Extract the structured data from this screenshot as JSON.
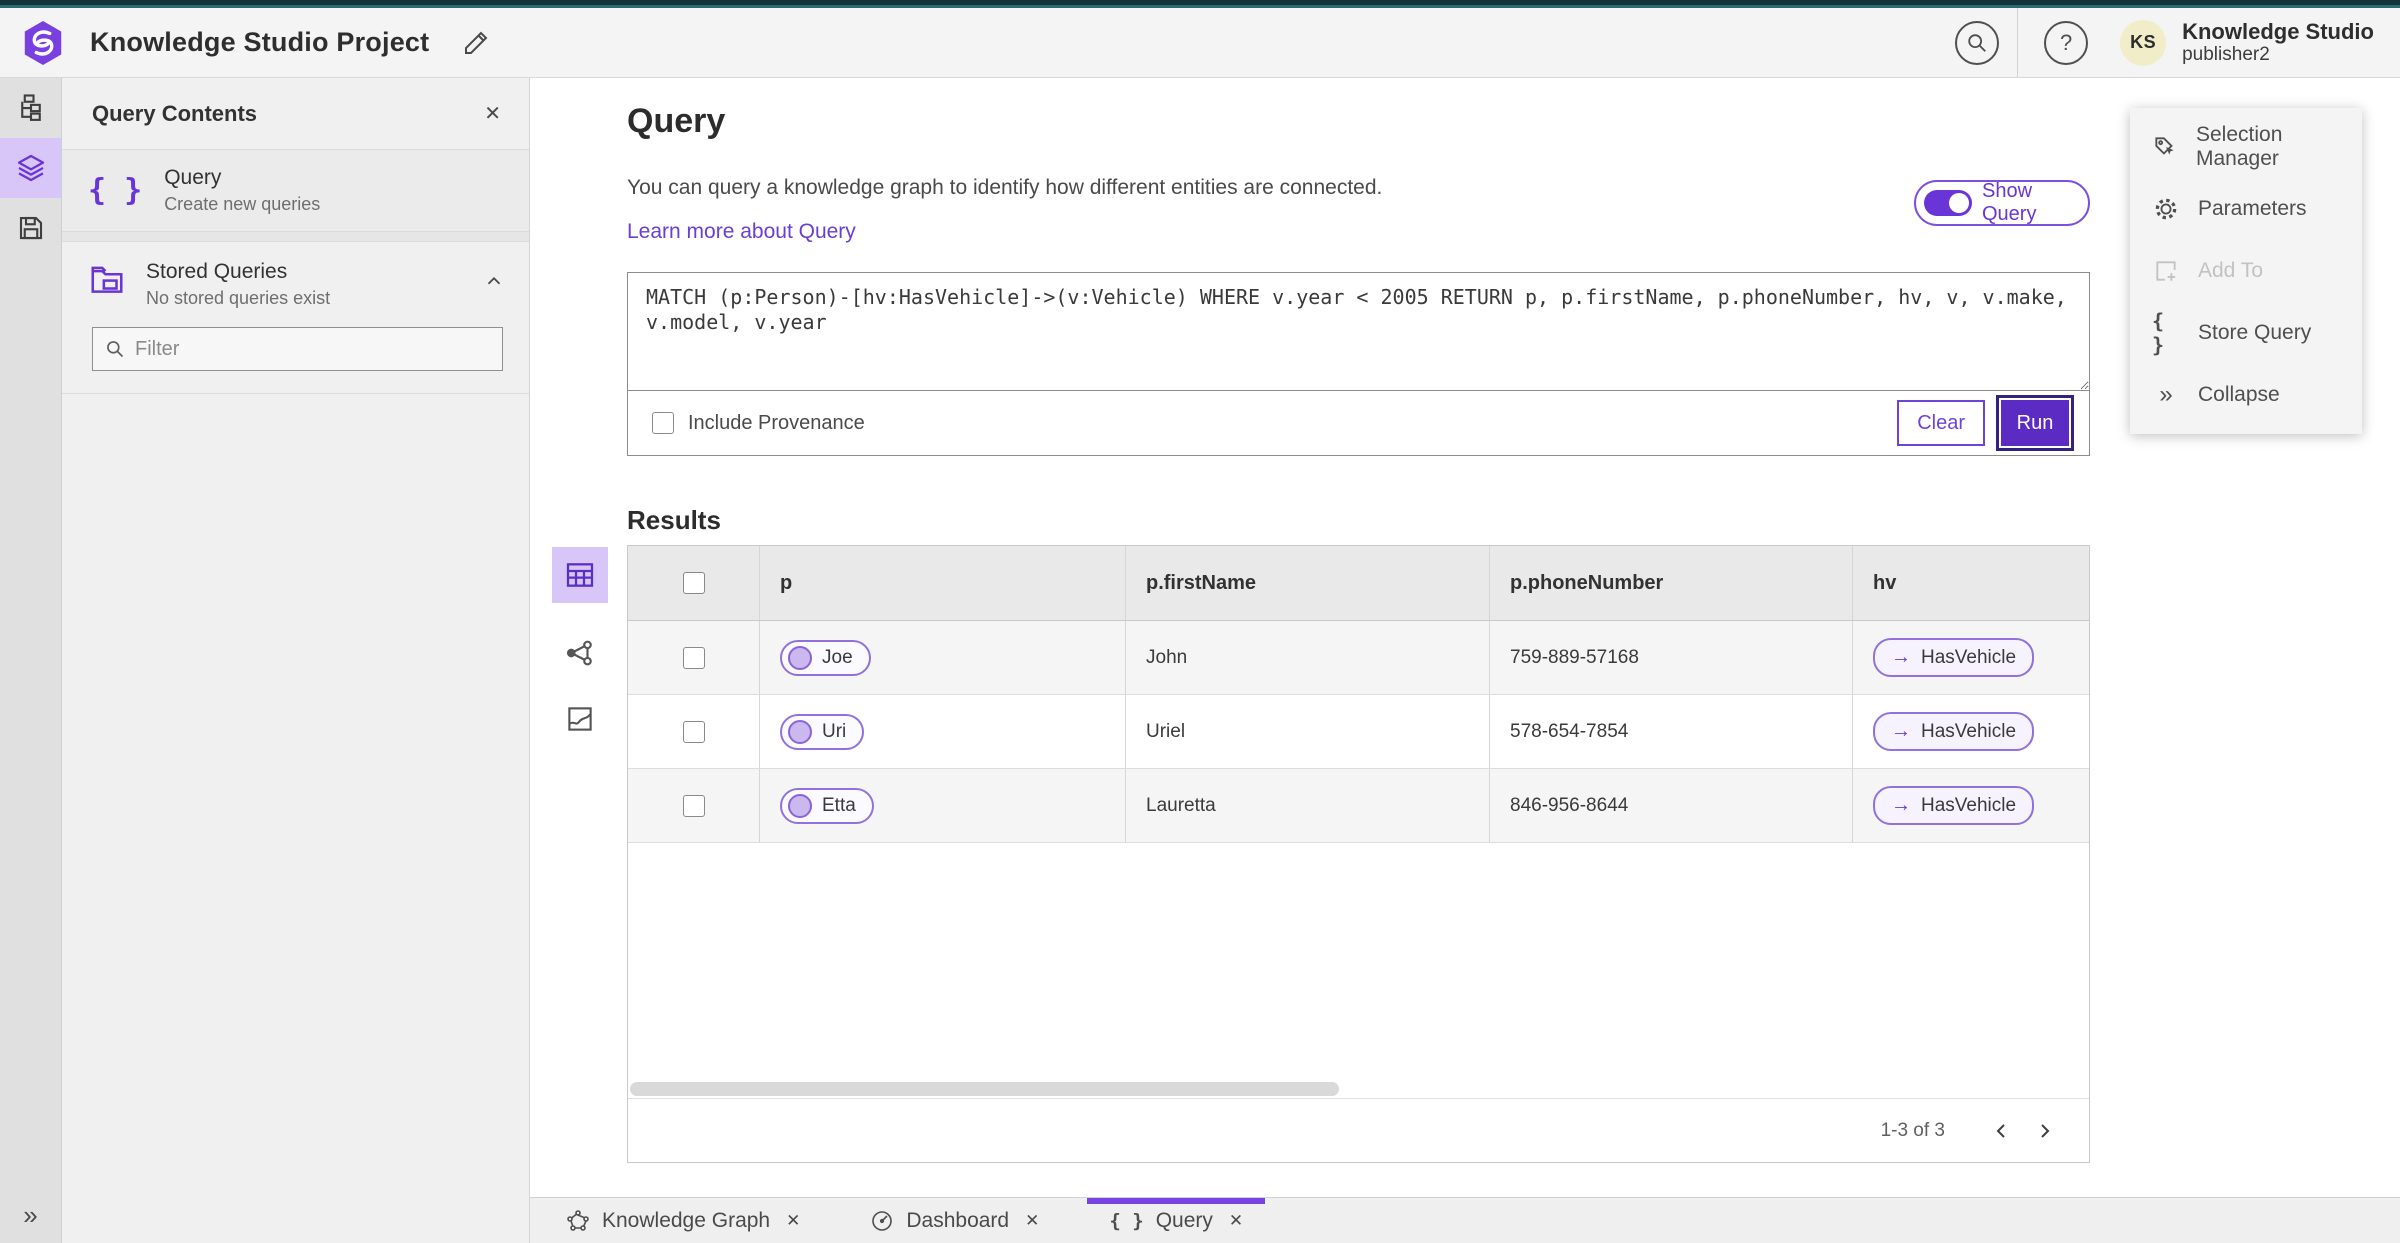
{
  "colors": {
    "accent": "#6a35d6",
    "accent_deep": "#5b2bc4",
    "accent_light": "#d9c6f8",
    "topbar": "#14323b"
  },
  "glyphs": {
    "close": "✕",
    "help": "?",
    "braces": "{ }",
    "collapse": "»",
    "expand": "»",
    "arrow_right": "→"
  },
  "header": {
    "title": "Knowledge Studio Project",
    "avatar_initials": "KS",
    "user_org": "Knowledge Studio",
    "user_name": "publisher2"
  },
  "left_panel": {
    "title": "Query Contents",
    "query_item": {
      "label": "Query",
      "sub": "Create new queries"
    },
    "stored_item": {
      "label": "Stored Queries",
      "sub": "No stored queries exist"
    },
    "filter_placeholder": "Filter"
  },
  "main": {
    "title": "Query",
    "description": "You can query a knowledge graph to identify how different entities are connected.",
    "learn_link": "Learn more about Query",
    "show_query_label": "Show Query",
    "query_text": "MATCH (p:Person)-[hv:HasVehicle]->(v:Vehicle) WHERE v.year < 2005 RETURN p, p.firstName, p.phoneNumber, hv, v, v.make, v.model, v.year",
    "include_provenance_label": "Include Provenance",
    "clear_label": "Clear",
    "run_label": "Run",
    "results_title": "Results"
  },
  "table": {
    "columns": [
      "p",
      "p.firstName",
      "p.phoneNumber",
      "hv"
    ],
    "rows": [
      {
        "entity": "Joe",
        "first": "John",
        "phone": "759-889-57168",
        "rel": "HasVehicle"
      },
      {
        "entity": "Uri",
        "first": "Uriel",
        "phone": "578-654-7854",
        "rel": "HasVehicle"
      },
      {
        "entity": "Etta",
        "first": "Lauretta",
        "phone": "846-956-8644",
        "rel": "HasVehicle"
      }
    ],
    "pagination": "1-3 of 3"
  },
  "right_panel": {
    "items": [
      {
        "label": "Selection Manager"
      },
      {
        "label": "Parameters"
      },
      {
        "label": "Add To",
        "disabled": true
      },
      {
        "label": "Store Query"
      },
      {
        "label": "Collapse"
      }
    ]
  },
  "tabs": [
    {
      "label": "Knowledge Graph"
    },
    {
      "label": "Dashboard"
    },
    {
      "label": "Query",
      "active": true
    }
  ]
}
